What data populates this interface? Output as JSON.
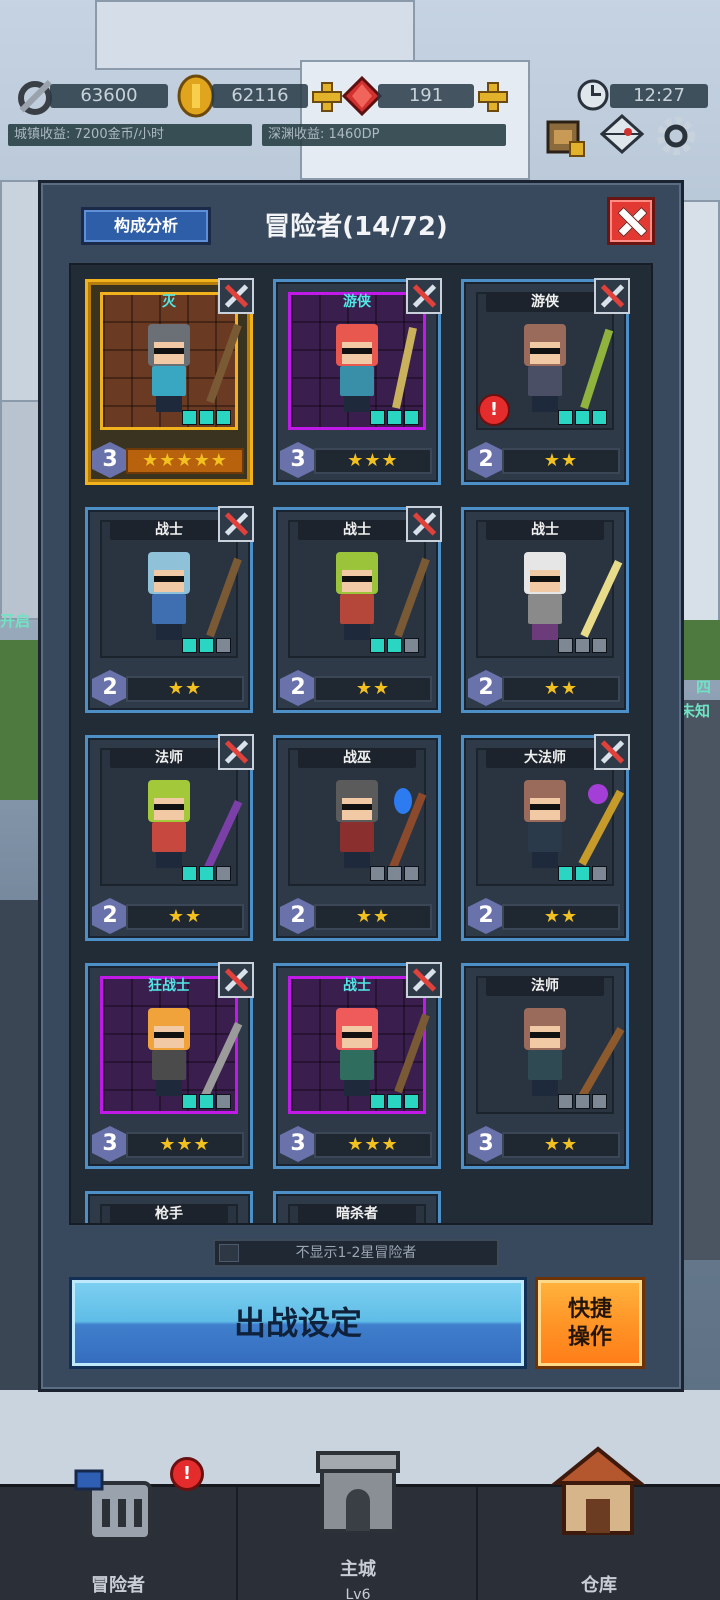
{
  "hud": {
    "power": "63600",
    "gold": "62116",
    "gems": "191",
    "time": "12:27",
    "town_income": "城镇收益: 7200金币/小时",
    "abyss_income": "深渊收益: 1460DP"
  },
  "panel": {
    "analysis_label": "构成分析",
    "title": "冒险者(14/72)",
    "filter_label": "不显示1-2星冒险者",
    "sortie_label": "出战设定",
    "quick_label_1": "快捷",
    "quick_label_2": "操作"
  },
  "cards": [
    {
      "class": "灭",
      "level": "3",
      "stars": "★★★★★"
    },
    {
      "class": "游侠",
      "level": "3",
      "stars": "★★★"
    },
    {
      "class": "游侠",
      "level": "2",
      "stars": "★★"
    },
    {
      "class": "战士",
      "level": "2",
      "stars": "★★"
    },
    {
      "class": "战士",
      "level": "2",
      "stars": "★★"
    },
    {
      "class": "战士",
      "level": "2",
      "stars": "★★"
    },
    {
      "class": "法师",
      "level": "2",
      "stars": "★★"
    },
    {
      "class": "战巫",
      "level": "2",
      "stars": "★★"
    },
    {
      "class": "大法师",
      "level": "2",
      "stars": "★★"
    },
    {
      "class": "狂战士",
      "level": "3",
      "stars": "★★★"
    },
    {
      "class": "战士",
      "level": "3",
      "stars": "★★★"
    },
    {
      "class": "法师",
      "level": "3",
      "stars": "★★"
    },
    {
      "class": "枪手"
    },
    {
      "class": "暗杀者"
    }
  ],
  "alert_mark": "!",
  "background": {
    "left_edge_text": "开启",
    "right_edge_text_1": "四",
    "right_edge_text_2": "未知"
  },
  "nav": {
    "adventurers": "冒险者",
    "main_city": "主城",
    "main_city_level": "Lv6",
    "warehouse": "仓库"
  }
}
